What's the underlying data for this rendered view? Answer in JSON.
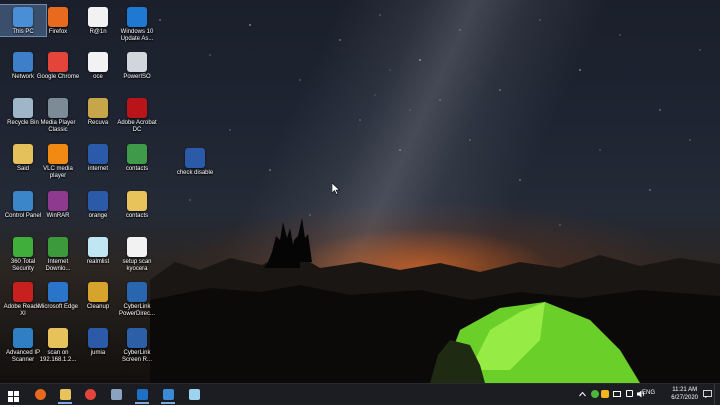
{
  "desktop_icons": [
    {
      "label": "This PC",
      "icon": "this-pc-icon",
      "color": "#4a8fd6"
    },
    {
      "label": "Network",
      "icon": "network-icon",
      "color": "#3d7fc9"
    },
    {
      "label": "Recycle Bin",
      "icon": "recycle-bin-icon",
      "color": "#9fb6c9"
    },
    {
      "label": "Said",
      "icon": "said-folder-icon",
      "color": "#e4c15a"
    },
    {
      "label": "Control Panel",
      "icon": "control-panel-icon",
      "color": "#3b86c8"
    },
    {
      "label": "360 Total Security",
      "icon": "360-total-security-icon",
      "color": "#3fae3a"
    },
    {
      "label": "Adobe Reader XI",
      "icon": "adobe-reader-icon",
      "color": "#c8201f"
    },
    {
      "label": "Advanced IP Scanner",
      "icon": "advanced-ip-scanner-icon",
      "color": "#2f7fc2"
    },
    {
      "label": "Firefox",
      "icon": "firefox-icon",
      "color": "#e76a1e"
    },
    {
      "label": "Google Chrome",
      "icon": "chrome-icon",
      "color": "#e4453a"
    },
    {
      "label": "Media Player Classic",
      "icon": "media-player-classic-icon",
      "color": "#7d8b96"
    },
    {
      "label": "VLC media player",
      "icon": "vlc-icon",
      "color": "#f08a12"
    },
    {
      "label": "WinRAR",
      "icon": "winrar-icon",
      "color": "#8e3a8f"
    },
    {
      "label": "Internet Downlo...",
      "icon": "internet-download-manager-icon",
      "color": "#3d9a3b"
    },
    {
      "label": "Microsoft Edge",
      "icon": "edge-icon",
      "color": "#2a74c9"
    },
    {
      "label": "scan on 192.168.1.2...",
      "icon": "shortcut-folder-icon",
      "color": "#e6c25c"
    },
    {
      "label": "R@1n",
      "icon": "document-icon",
      "color": "#f2f2f2"
    },
    {
      "label": "oce",
      "icon": "document-icon",
      "color": "#f2f2f2"
    },
    {
      "label": "Recuva",
      "icon": "recuva-icon",
      "color": "#c7a64a"
    },
    {
      "label": "internet",
      "icon": "word-document-icon",
      "color": "#2b5aa8"
    },
    {
      "label": "orange",
      "icon": "word-document-icon",
      "color": "#2b5aa8"
    },
    {
      "label": "realmlist",
      "icon": "text-file-icon",
      "color": "#bfe6f2"
    },
    {
      "label": "Cleanup",
      "icon": "cleanup-icon",
      "color": "#d6a32c"
    },
    {
      "label": "jumia",
      "icon": "word-document-icon",
      "color": "#2b5aa8"
    },
    {
      "label": "Windows 10 Update As...",
      "icon": "windows-update-icon",
      "color": "#1f78d1"
    },
    {
      "label": "PowerISO",
      "icon": "poweriso-icon",
      "color": "#d0d6dc"
    },
    {
      "label": "Adobe Acrobat DC",
      "icon": "acrobat-dc-icon",
      "color": "#b8141a"
    },
    {
      "label": "contacts",
      "icon": "contacts-icon",
      "color": "#3f9a4a"
    },
    {
      "label": "contacts",
      "icon": "folder-icon",
      "color": "#e8c25a"
    },
    {
      "label": "setup scan kyocera",
      "icon": "document-icon",
      "color": "#f2f2f2"
    },
    {
      "label": "CyberLink PowerDirec...",
      "icon": "powerdirector-icon",
      "color": "#2a66b0"
    },
    {
      "label": "CyberLink Screen R...",
      "icon": "screen-recorder-icon",
      "color": "#2c5fa6"
    },
    {
      "label": "check disable",
      "icon": "word-document-icon",
      "color": "#2b5aa8"
    }
  ],
  "taskbar": {
    "apps": [
      {
        "name": "start-button",
        "icon": "windows-start-icon",
        "color": "#ffffff"
      },
      {
        "name": "taskbar-firefox",
        "icon": "firefox-icon",
        "color": "#e76a1e"
      },
      {
        "name": "taskbar-file-explorer",
        "icon": "folder-icon",
        "color": "#e8c25a"
      },
      {
        "name": "taskbar-chrome",
        "icon": "chrome-icon",
        "color": "#e4453a"
      },
      {
        "name": "taskbar-device-manager",
        "icon": "device-manager-icon",
        "color": "#8aa3bf"
      },
      {
        "name": "taskbar-outlook",
        "icon": "outlook-icon",
        "color": "#1f6fc4"
      },
      {
        "name": "taskbar-remote-desktop",
        "icon": "remote-desktop-icon",
        "color": "#3a8ad6"
      },
      {
        "name": "taskbar-notepad",
        "icon": "notepad-icon",
        "color": "#9ed3ee"
      }
    ],
    "tray": {
      "language": "ENG",
      "time": "11:21 AM",
      "date": "6/27/2020"
    }
  }
}
